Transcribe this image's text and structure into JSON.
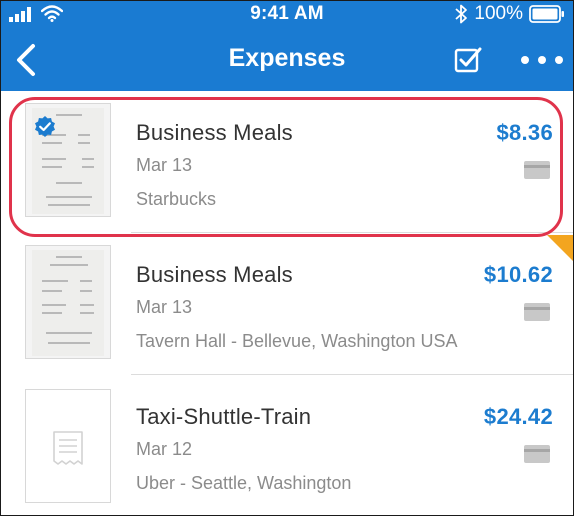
{
  "status_bar": {
    "time": "9:41 AM",
    "battery_percent": "100%",
    "icons": [
      "signal-icon",
      "wifi-icon",
      "bluetooth-icon",
      "battery-icon"
    ]
  },
  "nav": {
    "title": "Expenses",
    "back_icon": "chevron-left-icon",
    "select_icon": "checkbox-icon",
    "more_icon": "more-dots-icon"
  },
  "colors": {
    "header_bg": "#1a7bd2",
    "amount": "#1c7ccf",
    "highlight": "#e0334b",
    "flag": "#f3a51f"
  },
  "expenses": [
    {
      "category": "Business Meals",
      "amount": "$8.36",
      "date": "Mar 13",
      "merchant": "Starbucks",
      "has_receipt": true,
      "verified": true,
      "payment_icon": "credit-card-icon"
    },
    {
      "category": "Business Meals",
      "amount": "$10.62",
      "date": "Mar 13",
      "merchant": "Tavern Hall - Bellevue, Washington USA",
      "has_receipt": true,
      "verified": false,
      "payment_icon": "credit-card-icon"
    },
    {
      "category": "Taxi-Shuttle-Train",
      "amount": "$24.42",
      "date": "Mar 12",
      "merchant": "Uber - Seattle, Washington",
      "has_receipt": false,
      "verified": false,
      "payment_icon": "credit-card-icon"
    }
  ]
}
